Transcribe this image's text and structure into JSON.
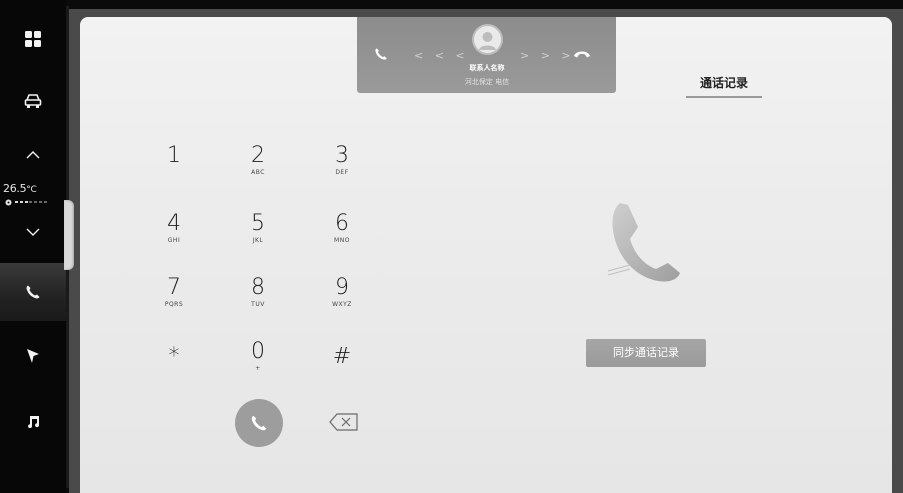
{
  "rail": {
    "temperature": "26.5",
    "temperature_unit": "°C",
    "items": [
      "apps-grid-icon",
      "car-icon",
      "chevron-up-icon",
      "chevron-down-icon",
      "phone-icon",
      "navigation-arrow-icon",
      "music-note-icon"
    ],
    "active": "phone-icon"
  },
  "call_banner": {
    "contact_name": "联系人名称",
    "contact_sub": "河北保定 电信",
    "left_chevrons": "< < <",
    "right_chevrons": "> > >"
  },
  "call_log_tab": {
    "label": "通话记录"
  },
  "keypad": {
    "keys": [
      {
        "digit": "1",
        "letters": ""
      },
      {
        "digit": "2",
        "letters": "ABC"
      },
      {
        "digit": "3",
        "letters": "DEF"
      },
      {
        "digit": "4",
        "letters": "GHI"
      },
      {
        "digit": "5",
        "letters": "JKL"
      },
      {
        "digit": "6",
        "letters": "MNO"
      },
      {
        "digit": "7",
        "letters": "PQRS"
      },
      {
        "digit": "8",
        "letters": "TUV"
      },
      {
        "digit": "9",
        "letters": "WXYZ"
      },
      {
        "digit": "*",
        "letters": ""
      },
      {
        "digit": "0",
        "letters": "+"
      },
      {
        "digit": "#",
        "letters": ""
      }
    ]
  },
  "empty_state": {
    "sync_button_label": "同步通话记录"
  },
  "colors": {
    "rail_bg": "#070707",
    "panel_bg": "#ececec",
    "banner_bg": "#919191",
    "dial_button": "#9d9d9d",
    "sync_button": "#a0a0a0"
  }
}
